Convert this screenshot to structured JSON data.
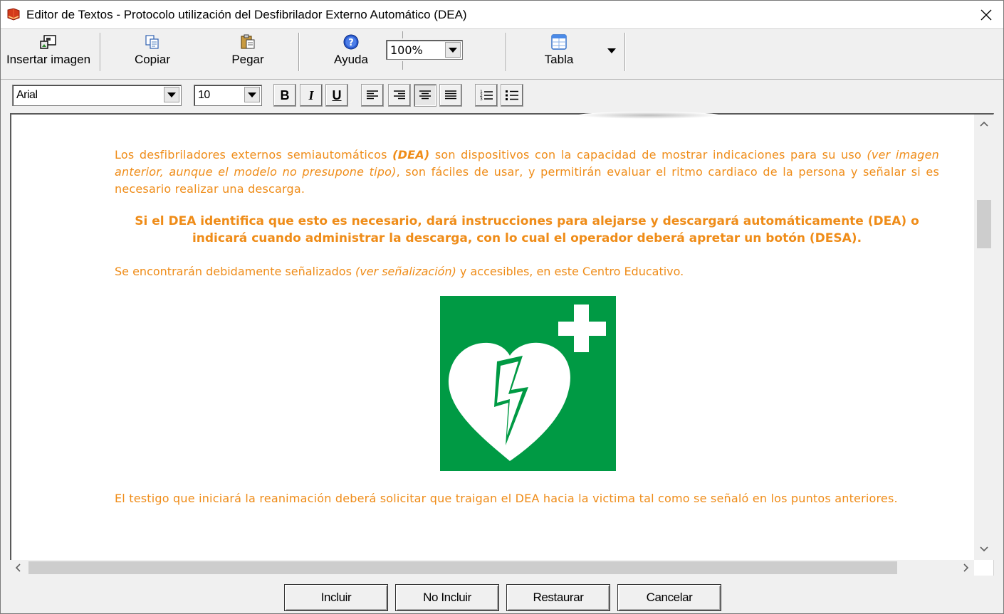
{
  "window": {
    "title": "Editor de Textos - Protocolo utilización del Desfibrilador Externo Automático (DEA)",
    "close_icon": "close-icon",
    "app_icon": "book-icon"
  },
  "toolbar": {
    "insert_image_label": "Insertar imagen",
    "copy_label": "Copiar",
    "paste_label": "Pegar",
    "help_label": "Ayuda",
    "zoom_value": "100%",
    "table_label": "Tabla"
  },
  "format_bar": {
    "font_family": "Arial",
    "font_size": "10",
    "bold_label": "B",
    "italic_label": "I",
    "underline_label": "U"
  },
  "document": {
    "text_color": "#ef8c18",
    "para1": {
      "t1": "Los desfibriladores externos semiautomáticos ",
      "t2": "(DEA)",
      "t3": " son dispositivos con la capacidad de mostrar indicaciones para su uso ",
      "t4": "(ver imagen anterior, aunque el modelo no presupone tipo)",
      "t5": ", son fáciles de usar, y permitirán evaluar el ritmo cardiaco de la persona y señalar si es necesario realizar una descarga."
    },
    "para2": "Si el DEA identifica que esto es necesario, dará instrucciones para alejarse y descargará automáticamente (DEA) o indicará cuando administrar la descarga, con lo cual el operador deberá apretar un botón (DESA).",
    "para3": {
      "t1": "Se encontrarán debidamente señalizados ",
      "t2": "(ver señalización)",
      "t3": " y accesibles, en este Centro Educativo."
    },
    "para4": "El testigo que iniciará la reanimación deberá solicitar que traigan el DEA hacia la victima tal como se señaló en los puntos anteriores.",
    "sign": {
      "icon": "aed-sign-icon",
      "background": "#009a44"
    }
  },
  "buttons": {
    "include": "Incluir",
    "not_include": "No Incluir",
    "restore": "Restaurar",
    "cancel": "Cancelar"
  }
}
